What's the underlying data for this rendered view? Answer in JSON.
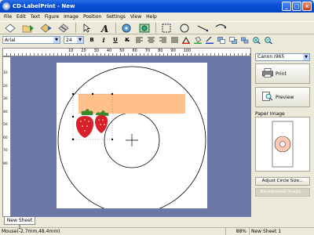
{
  "window": {
    "title": "CD-LabelPrint - New",
    "min": "_",
    "max": "□",
    "close": "×"
  },
  "menu": [
    "File",
    "Edit",
    "Text",
    "Figure",
    "Image",
    "Position",
    "Settings",
    "View",
    "Help"
  ],
  "format": {
    "font": "Arial",
    "size": "24",
    "bold": "B",
    "italic": "I",
    "underline": "U",
    "strike": "K"
  },
  "ruler": {
    "ticks": [
      "10",
      "20",
      "30",
      "40",
      "50",
      "60",
      "70",
      "80",
      "90",
      "100"
    ],
    "vticks": [
      "10",
      "20",
      "30",
      "40",
      "50",
      "60",
      "70",
      "80"
    ]
  },
  "canvas": {
    "label_fill": "#ffc08c",
    "berry": "#d8202a"
  },
  "sheet_tab": "New Sheet 1",
  "status": {
    "mouse": "Mouse(-2.7mm,48.4mm)",
    "zoom": "88%",
    "sheet": "New Sheet 1"
  },
  "panel": {
    "printer": "Canon i965",
    "print": "Print",
    "preview": "Preview",
    "paper_label": "Paper Image",
    "adjust": "Adjust Circle Size...",
    "background": "Background Image..."
  },
  "icons": [
    "new-label-icon",
    "open-icon",
    "save-icon",
    "export-icon",
    "select-arrow-icon",
    "text-tool-icon",
    "disc-icon",
    "import-image-icon",
    "rectangle-tool-icon",
    "ellipse-tool-icon",
    "line-tool-icon",
    "arc-tool-icon"
  ]
}
